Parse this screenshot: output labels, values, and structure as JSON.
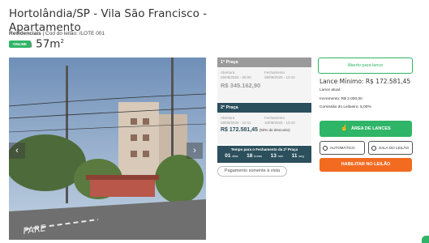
{
  "listing": {
    "title_line1": "Hortolândia/SP - Vila São Francisco - Apartamento",
    "title_line2": "com 57m",
    "title_sup": "2",
    "category": "Residenciais",
    "lot_info": " | Cod do leilão: /LOTE 001",
    "status_badge": "ONLINE"
  },
  "photo": {
    "watermark": "PARE"
  },
  "praca1": {
    "header": "1ª Praça",
    "opening_label": "Abertura",
    "opening_date": "25/08/2025 - 09:00",
    "closing_label": "Fechamento",
    "closing_date": "08/09/2025 - 10:10",
    "price": "R$ 345.162,90"
  },
  "praca2": {
    "header": "2ª Praça",
    "opening_label": "Abertura",
    "opening_date": "08/09/2025 - 10:11",
    "closing_label": "Fechamento",
    "closing_date": "10/09/2025 - 10:10",
    "price": "R$ 172.581,45",
    "discount": "(50% de desconto)"
  },
  "countdown": {
    "title": "Tempo para o Fechamento da 2ª Praça",
    "days": "01",
    "days_label": "dias",
    "hours": "18",
    "hours_label": "horas",
    "minutes": "13",
    "minutes_label": "min",
    "seconds": "11",
    "seconds_label": "seg"
  },
  "payment_pill": "Pagamento somente à vista",
  "bid_panel": {
    "open_button": "Aberto para lance",
    "lance_minimo": "Lance Mínimo: R$ 172.581,45",
    "lance_atual": "Lance atual:",
    "incremento": "Incremento: R$ 2.000,00",
    "comissao": "Comissão do Leiloeiro: 5,00%",
    "area_button": "ÁREA DE LANCES",
    "auto_button": "AUTOMÁTICO",
    "sala_button": "SALA DO LEILÃO",
    "habilitar_button": "HABILITAR NO LEILÃO"
  },
  "colors": {
    "green": "#2fb567",
    "teal": "#2b4f5c",
    "orange": "#f26b21",
    "gray": "#9a9a9a"
  }
}
